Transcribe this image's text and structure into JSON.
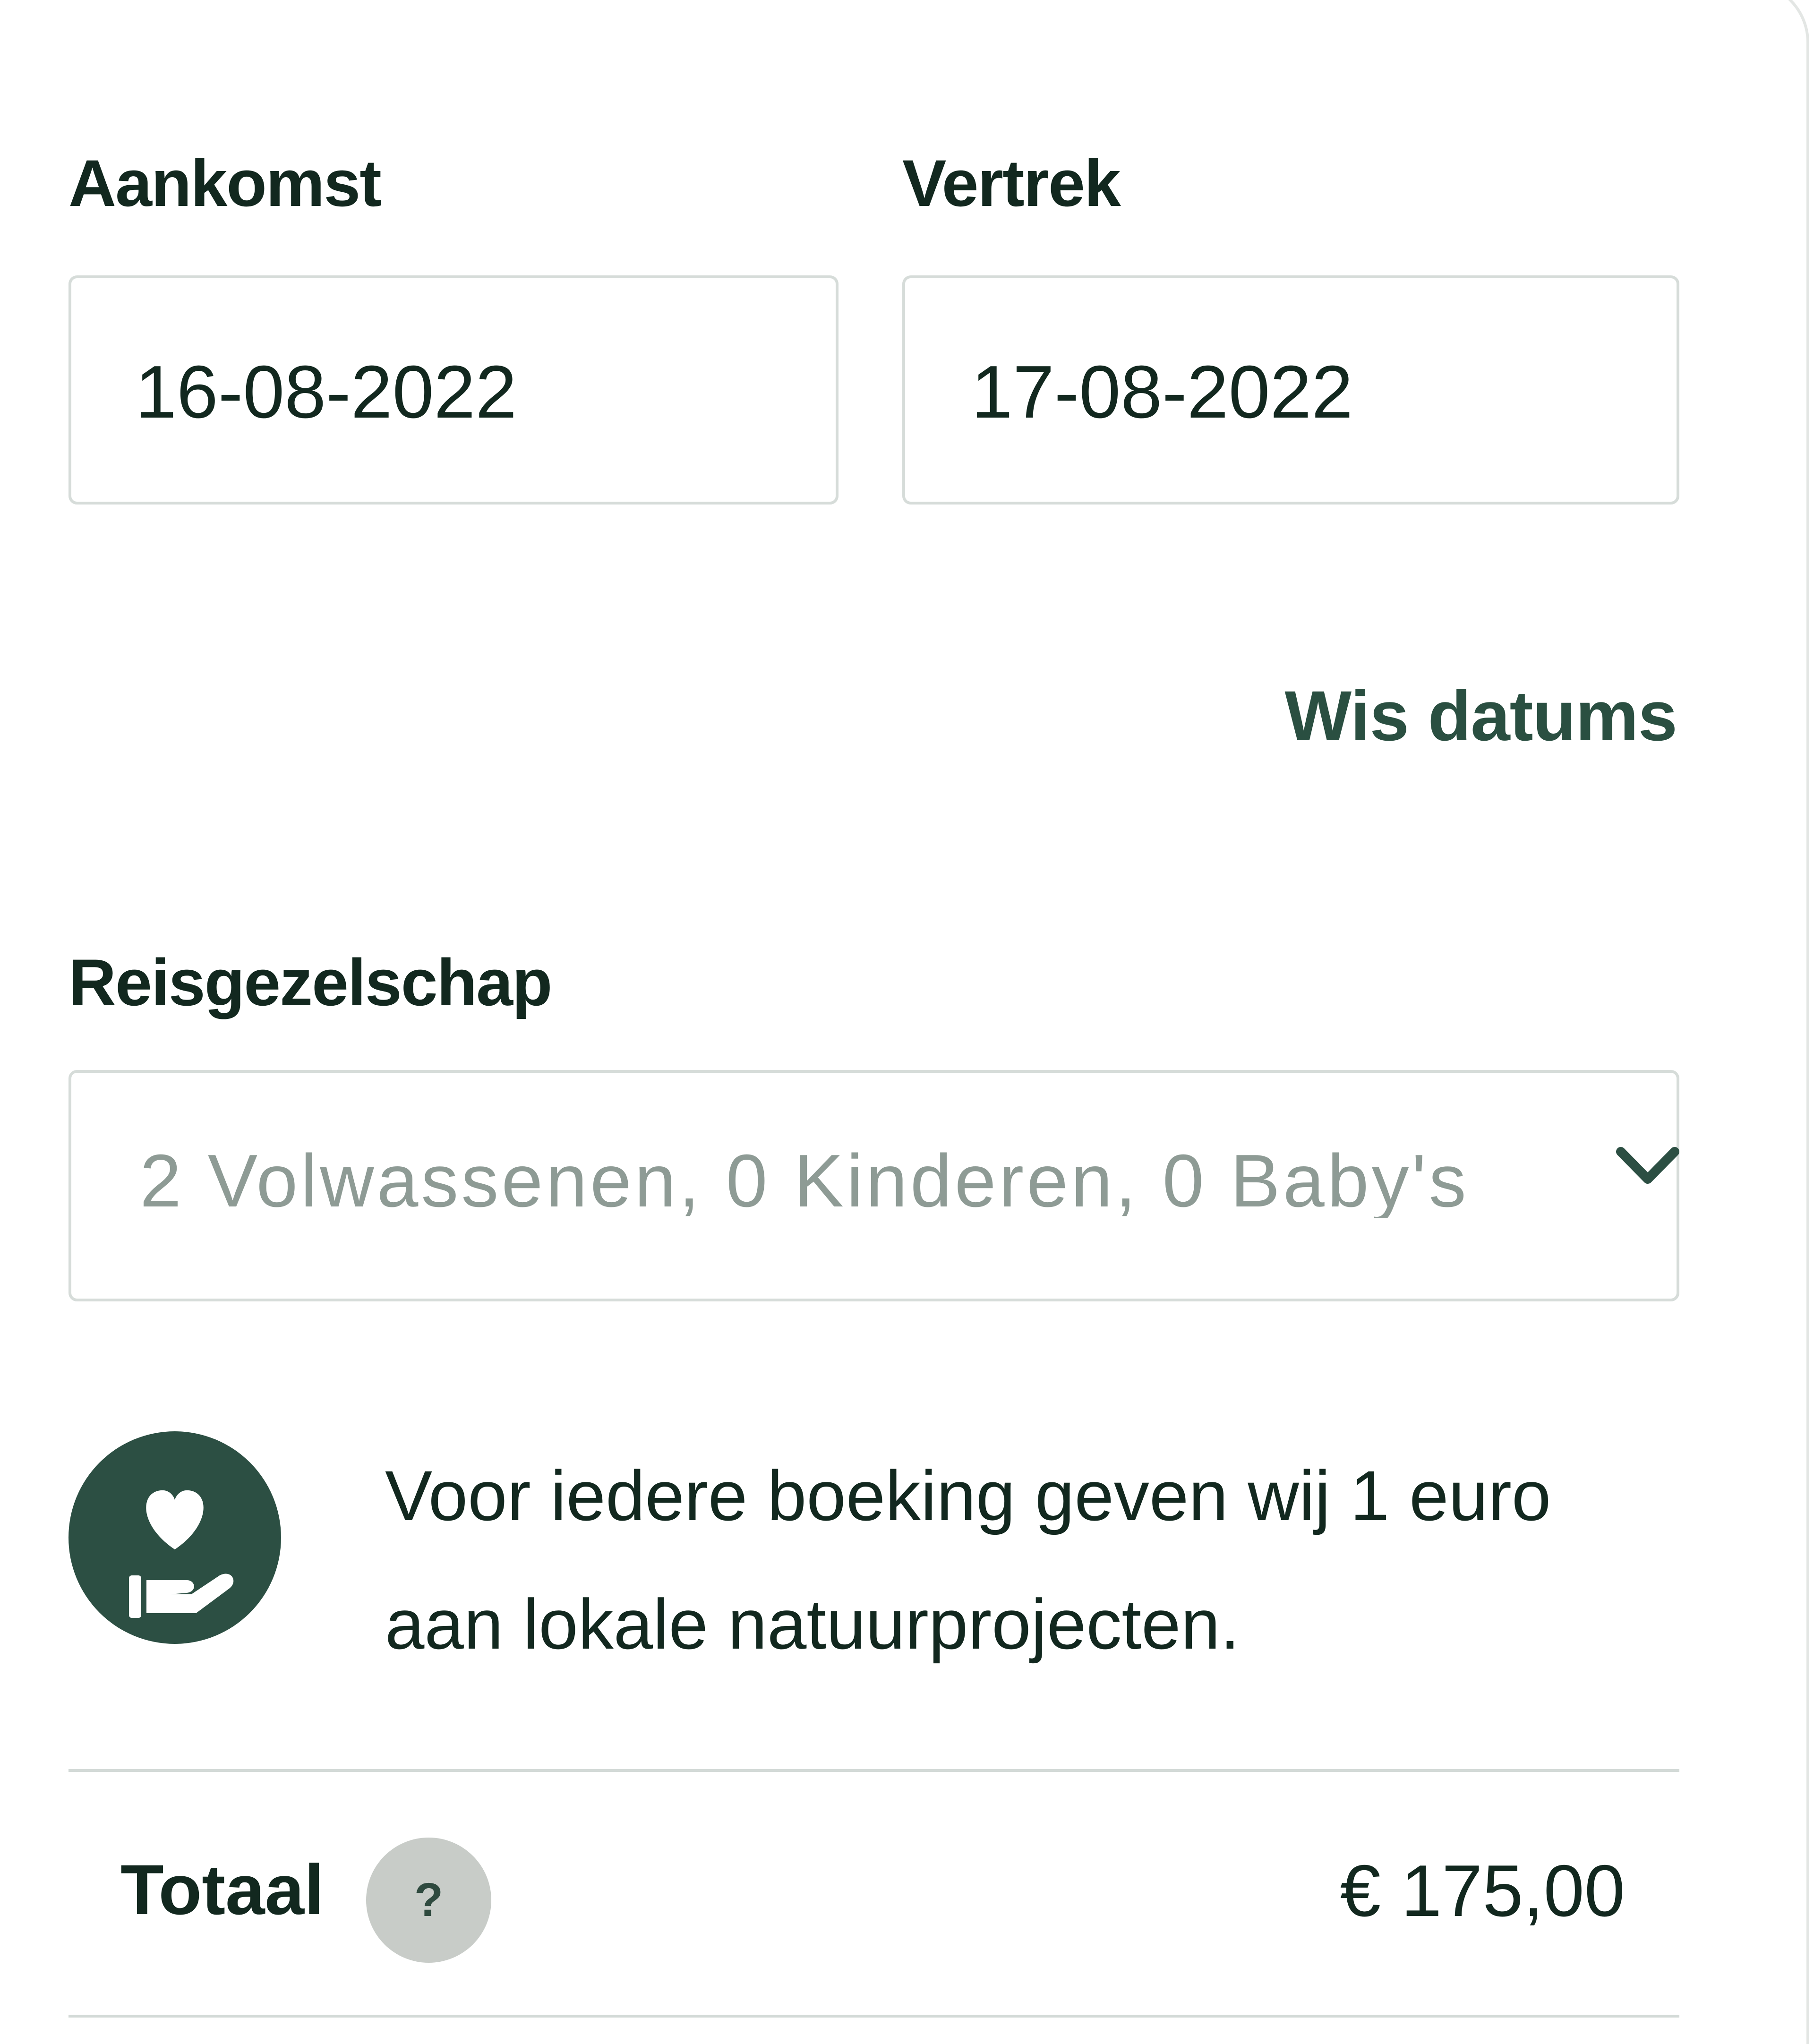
{
  "dates": {
    "arrival_label": "Aankomst",
    "arrival_value": "16-08-2022",
    "departure_label": "Vertrek",
    "departure_value": "17-08-2022",
    "clear_label": "Wis datums"
  },
  "guests": {
    "label": "Reisgezelschap",
    "value": "2 Volwassenen, 0 Kinderen, 0 Baby's",
    "icon": "chevron-down-icon"
  },
  "donation": {
    "icon": "heart-hand-icon",
    "text": "Voor iedere boeking geven wij 1 euro aan lokale natuurprojecten."
  },
  "total": {
    "label": "Totaal",
    "help_symbol": "?",
    "value": "€ 175,00"
  },
  "colors": {
    "brand": "#2c4f43",
    "text": "#12281f",
    "placeholder": "#8e9b95",
    "border": "#d6dcd9"
  }
}
